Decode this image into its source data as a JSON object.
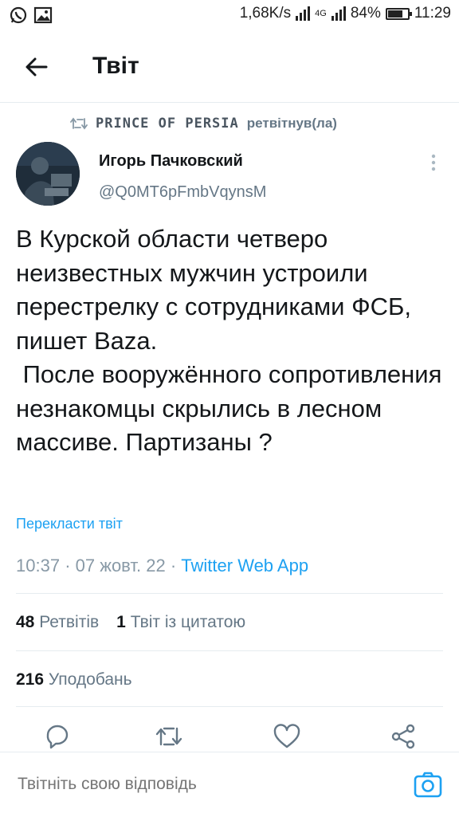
{
  "status_bar": {
    "network_speed": "1,68K/s",
    "network_type": "4G",
    "battery_percent": "84%",
    "time": "11:29",
    "battery_level": 0.84
  },
  "header": {
    "title": "Твіт"
  },
  "retweet": {
    "name": "PRINCE OF PERSIA",
    "suffix": "ретвітнув(ла)"
  },
  "tweet": {
    "author_name": "Игорь Пачковский",
    "author_handle": "@Q0MT6pFmbVqynsM",
    "text": "В Курской области четверо неизвестных мужчин устроили перестрелку с сотрудниками ФСБ, пишет Baza.\n После вооружённого сопротивления незнакомцы скрылись в лесном массиве. Партизаны ?",
    "translate_label": "Перекласти твіт",
    "time": "10:37",
    "date": "07 жовт. 22",
    "source": "Twitter Web App",
    "separator": "·"
  },
  "stats": {
    "retweets_count": "48",
    "retweets_label": "Ретвітів",
    "quotes_count": "1",
    "quotes_label": "Твіт із цитатою",
    "likes_count": "216",
    "likes_label": "Уподобань"
  },
  "reply": {
    "placeholder": "Твітніть свою відповідь"
  },
  "colors": {
    "accent": "#1da1f2",
    "text_primary": "#14171a",
    "text_secondary": "#657786",
    "border": "#e6ecf0"
  },
  "icons": {
    "back": "arrow-left-icon",
    "more": "more-vertical-icon",
    "retweet": "retweet-icon",
    "reply": "reply-icon",
    "like": "heart-icon",
    "share": "share-icon",
    "camera": "camera-icon"
  }
}
